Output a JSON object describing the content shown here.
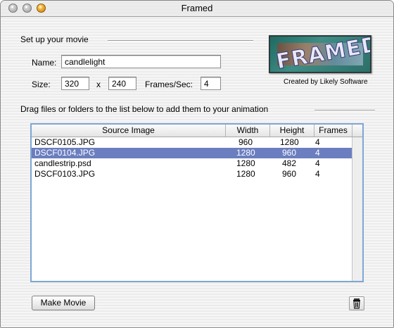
{
  "window": {
    "title": "Framed"
  },
  "setup": {
    "section_label": "Set up your movie",
    "name_label": "Name:",
    "name_value": "candlelight",
    "size_label": "Size:",
    "width_value": "320",
    "x_label": "x",
    "height_value": "240",
    "fps_label": "Frames/Sec:",
    "fps_value": "4"
  },
  "logo": {
    "text": "FRAMED",
    "credit": "Created by Likely Software"
  },
  "list": {
    "instructions": "Drag files or folders to the list below to add them to your animation",
    "columns": [
      "Source Image",
      "Width",
      "Height",
      "Frames"
    ],
    "rows": [
      {
        "source": "DSCF0105.JPG",
        "width": "960",
        "height": "1280",
        "frames": "4",
        "selected": false
      },
      {
        "source": "DSCF0104.JPG",
        "width": "1280",
        "height": "960",
        "frames": "4",
        "selected": true
      },
      {
        "source": "candlestrip.psd",
        "width": "1280",
        "height": "482",
        "frames": "4",
        "selected": false
      },
      {
        "source": "DSCF0103.JPG",
        "width": "1280",
        "height": "960",
        "frames": "4",
        "selected": false
      }
    ]
  },
  "actions": {
    "make_movie_label": "Make Movie",
    "trash_icon": "trash-icon"
  },
  "colors": {
    "selection": "#6b7ebf",
    "table_border": "#7fa6d4"
  }
}
